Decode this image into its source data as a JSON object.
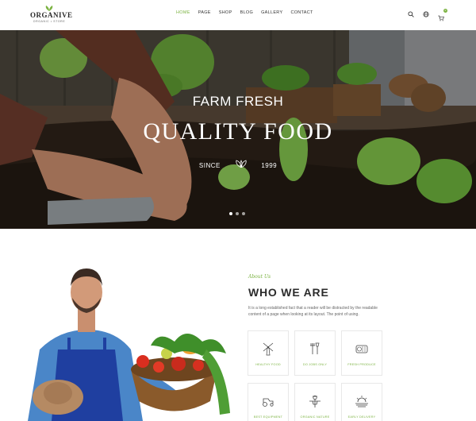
{
  "brand": {
    "name": "ORGANIVE",
    "tagline": "ORGANIC • STORE",
    "accent": "#7cb342"
  },
  "nav": {
    "items": [
      {
        "label": "HOME",
        "active": true
      },
      {
        "label": "PAGE",
        "active": false
      },
      {
        "label": "SHOP",
        "active": false
      },
      {
        "label": "BLOG",
        "active": false
      },
      {
        "label": "GALLERY",
        "active": false
      },
      {
        "label": "CONTACT",
        "active": false
      }
    ],
    "icons": [
      "search-icon",
      "globe-icon",
      "cart-icon"
    ],
    "cart_count": "0"
  },
  "hero": {
    "subtitle": "FARM FRESH",
    "title": "QUALITY FOOD",
    "since_label": "SINCE",
    "since_year": "1999",
    "slides": 3,
    "active_slide": 1
  },
  "about": {
    "tag": "About Us",
    "title": "WHO WE ARE",
    "text": "It is a long established fact that a reader will be distracted by the readable content of a page when looking at its layout. The point of using.",
    "features": [
      {
        "label": "HEALTHY FOOD",
        "icon": "windmill-icon"
      },
      {
        "label": "DO JOBS ONLY",
        "icon": "garden-tools-icon"
      },
      {
        "label": "FRESH PRODUCE",
        "icon": "hay-bale-icon"
      },
      {
        "label": "BEST EQUIPMENT",
        "icon": "tractor-icon"
      },
      {
        "label": "ORGANIC NATURE",
        "icon": "scarecrow-icon"
      },
      {
        "label": "EARLY DELIVERY",
        "icon": "sunrise-field-icon"
      }
    ]
  }
}
